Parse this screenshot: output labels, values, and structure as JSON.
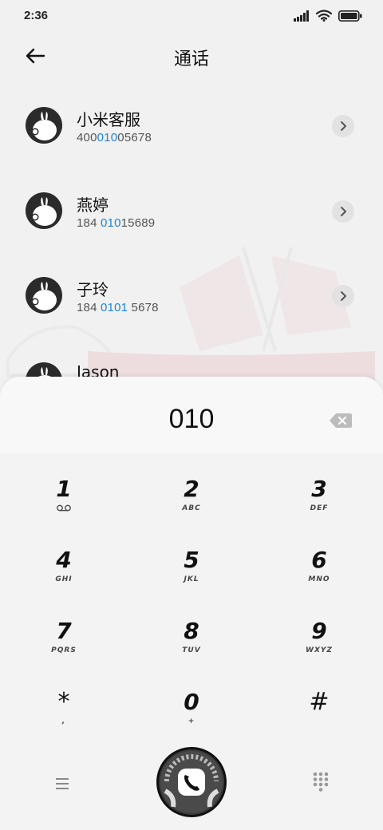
{
  "status": {
    "time": "2:36"
  },
  "header": {
    "title": "通话"
  },
  "contacts": [
    {
      "name": "小米客服",
      "number_pre": "400",
      "number_hl": "010",
      "number_post": "05678"
    },
    {
      "name": "燕婷",
      "number_pre": "184 ",
      "number_hl": "010",
      "number_post": "15689"
    },
    {
      "name": "子玲",
      "number_pre": "184 ",
      "number_hl": "0101",
      "number_post": " 5678"
    },
    {
      "name": "Jason",
      "number_pre": "",
      "number_hl": "",
      "number_post": ""
    }
  ],
  "dialer": {
    "number": "010",
    "keys": [
      {
        "digit": "1",
        "letters": ""
      },
      {
        "digit": "2",
        "letters": "ABC"
      },
      {
        "digit": "3",
        "letters": "DEF"
      },
      {
        "digit": "4",
        "letters": "GHI"
      },
      {
        "digit": "5",
        "letters": "JKL"
      },
      {
        "digit": "6",
        "letters": "MNO"
      },
      {
        "digit": "7",
        "letters": "PQRS"
      },
      {
        "digit": "8",
        "letters": "TUV"
      },
      {
        "digit": "9",
        "letters": "WXYZ"
      },
      {
        "digit": "*",
        "letters": ","
      },
      {
        "digit": "0",
        "letters": "+"
      },
      {
        "digit": "#",
        "letters": ""
      }
    ]
  },
  "colors": {
    "highlight": "#1a86d8",
    "background": "#f1f1f1"
  },
  "icons": [
    "signal-icon",
    "wifi-icon",
    "battery-icon",
    "back-arrow-icon",
    "chevron-right-icon",
    "backspace-icon",
    "voicemail-icon",
    "menu-icon",
    "phone-icon",
    "dialpad-icon"
  ]
}
